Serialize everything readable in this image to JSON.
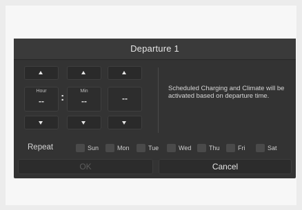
{
  "dialog": {
    "title": "Departure 1",
    "info_text": "Scheduled Charging and Climate will be activated based on departure time."
  },
  "time_picker": {
    "hour": {
      "label": "Hour",
      "value": "--"
    },
    "minute": {
      "label": "Min",
      "value": "--"
    },
    "ampm": {
      "value": "--"
    },
    "separator": ":"
  },
  "repeat": {
    "label": "Repeat",
    "days": [
      "Sun",
      "Mon",
      "Tue",
      "Wed",
      "Thu",
      "Fri",
      "Sat"
    ],
    "selected": []
  },
  "buttons": {
    "ok_label": "OK",
    "ok_enabled": false,
    "cancel_label": "Cancel"
  },
  "icons": {
    "up": "chevron-up-icon",
    "down": "chevron-down-icon"
  }
}
